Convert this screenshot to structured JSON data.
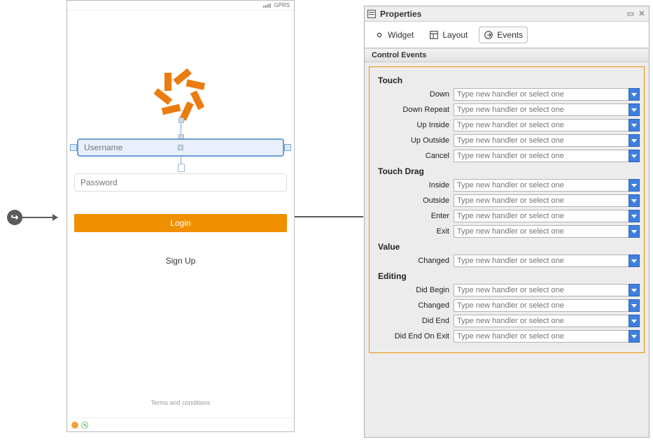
{
  "phone": {
    "statusbar_network": "GPRS",
    "username_placeholder": "Username",
    "password_placeholder": "Password",
    "login_label": "Login",
    "signup_label": "Sign Up",
    "terms_label": "Terms and conditions"
  },
  "panel": {
    "title": "Properties",
    "tabs": {
      "widget": "Widget",
      "layout": "Layout",
      "events": "Events"
    },
    "section_title": "Control Events",
    "combo_placeholder": "Type new handler or select one",
    "groups": [
      {
        "title": "Touch",
        "events": [
          "Down",
          "Down Repeat",
          "Up Inside",
          "Up Outside",
          "Cancel"
        ]
      },
      {
        "title": "Touch Drag",
        "events": [
          "Inside",
          "Outside",
          "Enter",
          "Exit"
        ]
      },
      {
        "title": "Value",
        "events": [
          "Changed"
        ]
      },
      {
        "title": "Editing",
        "events": [
          "Did Begin",
          "Changed",
          "Did End",
          "Did End On Exit"
        ]
      }
    ]
  }
}
